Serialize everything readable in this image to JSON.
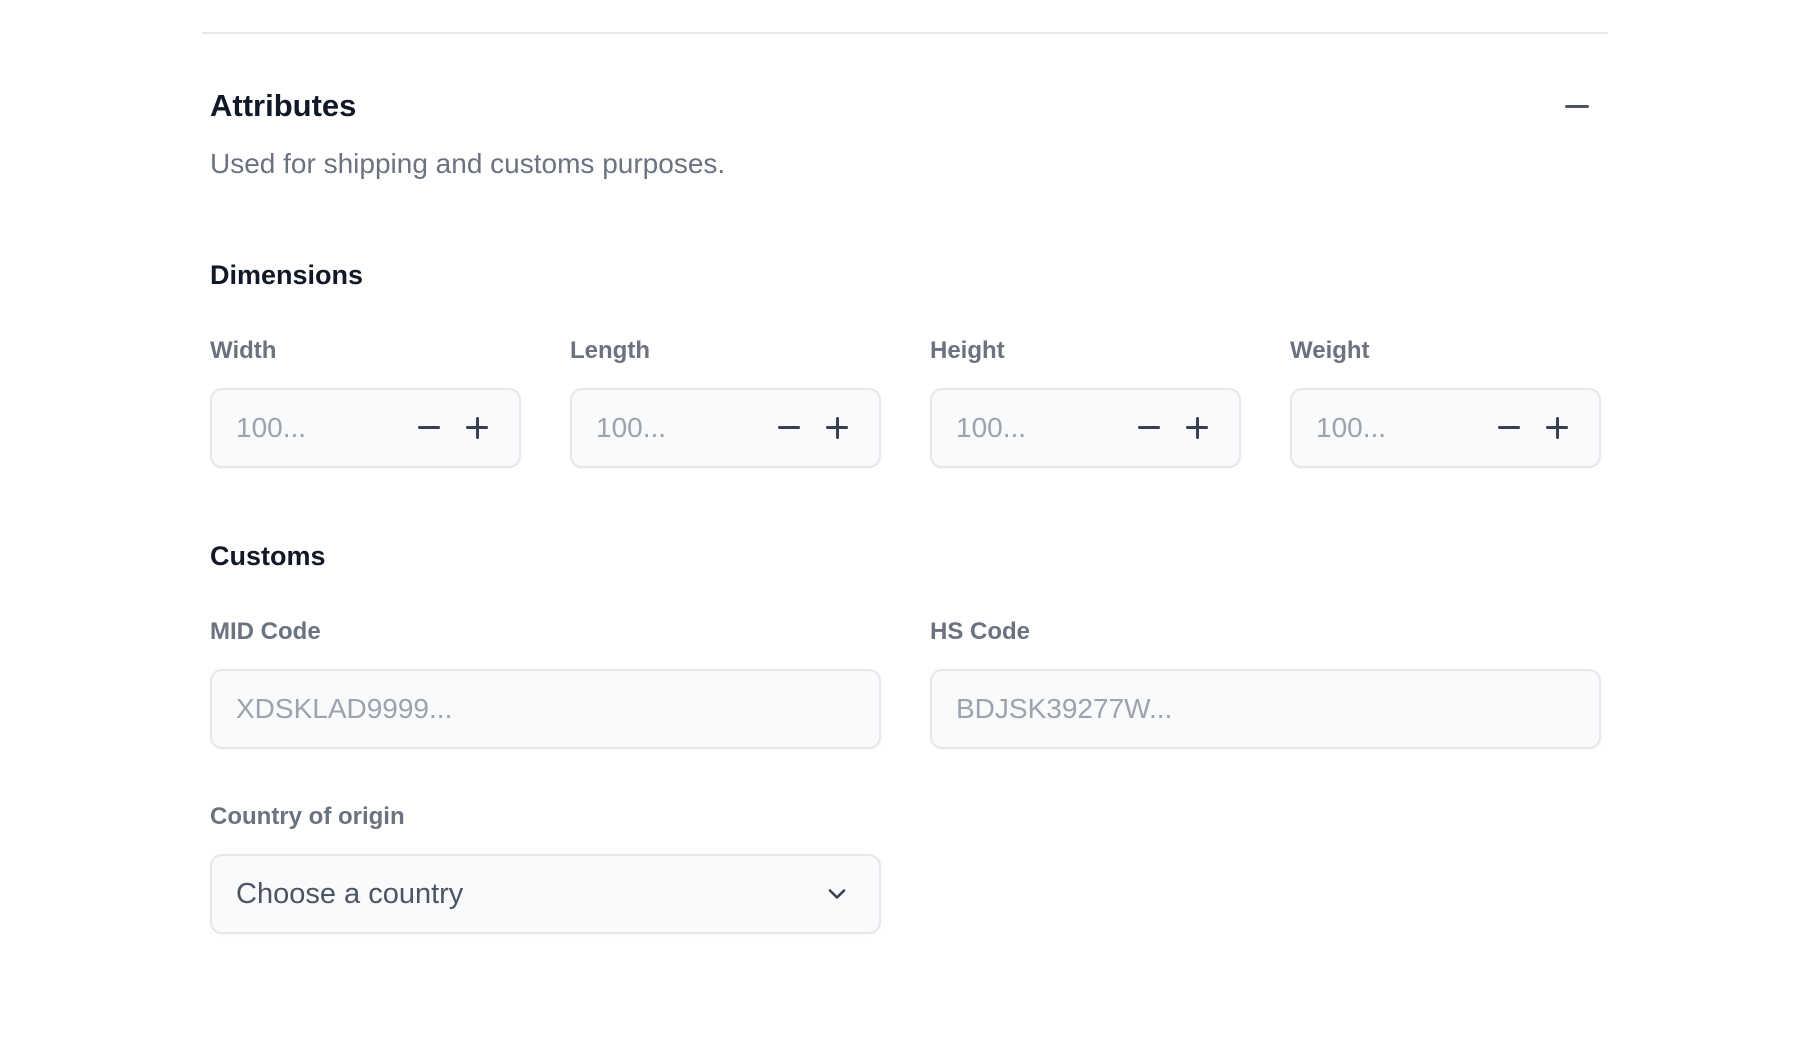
{
  "section": {
    "title": "Attributes",
    "subtitle": "Used for shipping and customs purposes.",
    "collapse_icon": "minus-icon"
  },
  "dimensions": {
    "title": "Dimensions",
    "fields": [
      {
        "label": "Width",
        "placeholder": "100..."
      },
      {
        "label": "Length",
        "placeholder": "100..."
      },
      {
        "label": "Height",
        "placeholder": "100..."
      },
      {
        "label": "Weight",
        "placeholder": "100..."
      }
    ]
  },
  "customs": {
    "title": "Customs",
    "mid_code": {
      "label": "MID Code",
      "placeholder": "XDSKLAD9999..."
    },
    "hs_code": {
      "label": "HS Code",
      "placeholder": "BDJSK39277W..."
    },
    "country": {
      "label": "Country of origin",
      "selected": "Choose a country"
    }
  },
  "colors": {
    "heading": "#111827",
    "label": "#6b7280",
    "placeholder": "#9ca3af",
    "input_bg": "#f9fafb",
    "border": "#e5e7eb"
  }
}
